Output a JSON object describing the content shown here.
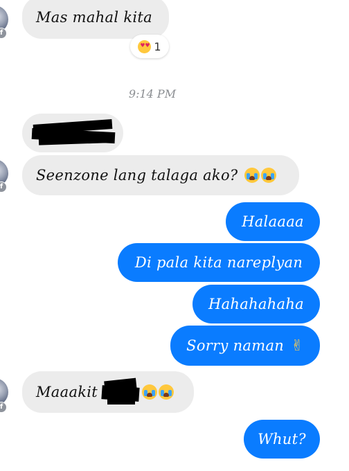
{
  "conversation": {
    "timestamp": "9:14 PM",
    "messages": [
      {
        "id": "m1",
        "side": "in",
        "text": "Mas mahal kita",
        "reaction": {
          "emoji": "heart-eyes",
          "count": "1"
        }
      },
      {
        "id": "m2",
        "side": "in",
        "text": "",
        "redacted": true
      },
      {
        "id": "m3",
        "side": "in",
        "text": "Seenzone lang talaga ako?",
        "emoji": [
          "loudly-crying-face",
          "loudly-crying-face"
        ]
      },
      {
        "id": "m4",
        "side": "out",
        "text": "Halaaaa"
      },
      {
        "id": "m5",
        "side": "out",
        "text": "Di pala kita nareplyan"
      },
      {
        "id": "m6",
        "side": "out",
        "text": "Hahahahaha"
      },
      {
        "id": "m7",
        "side": "out",
        "text": "Sorry naman",
        "emoji": [
          "victory-hand"
        ]
      },
      {
        "id": "m8",
        "side": "in",
        "text": "Maaakit",
        "redacted_part": true,
        "emoji": [
          "loudly-crying-face",
          "loudly-crying-face"
        ]
      },
      {
        "id": "m9",
        "side": "out",
        "text": "Whut?"
      }
    ]
  },
  "colors": {
    "incoming_bubble": "#ececec",
    "outgoing_bubble": "#0a7cff",
    "incoming_text": "#111111",
    "outgoing_text": "#ffffff",
    "timestamp_text": "#8a8d91",
    "background": "#ffffff"
  },
  "icons": {
    "avatar_badge": "facebook-badge-icon",
    "victory": "✌"
  }
}
